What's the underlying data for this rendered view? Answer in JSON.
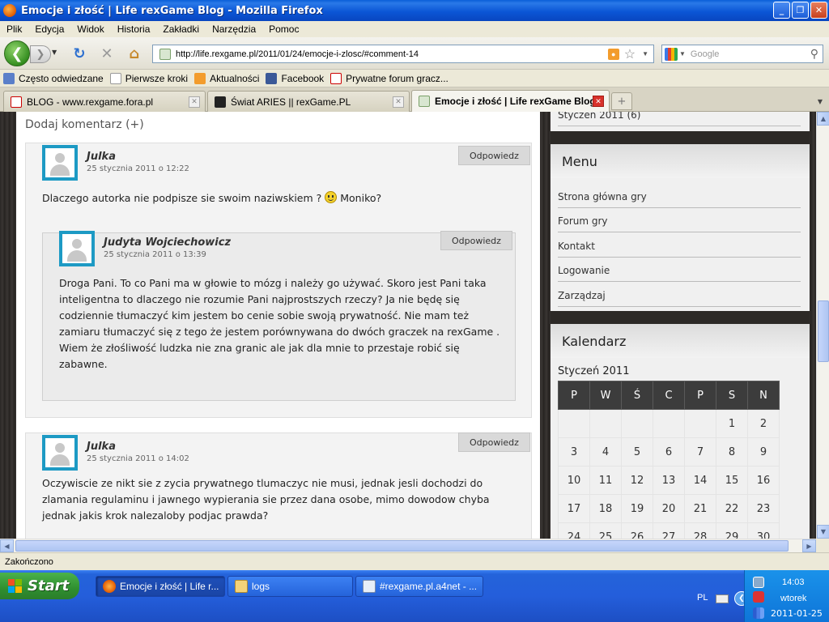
{
  "window": {
    "title": "Emocje i złość | Life rexGame Blog - Mozilla Firefox",
    "buttons": {
      "minimize": "_",
      "maximize": "❐",
      "close": "✕"
    }
  },
  "menu": [
    "Plik",
    "Edycja",
    "Widok",
    "Historia",
    "Zakładki",
    "Narzędzia",
    "Pomoc"
  ],
  "nav": {
    "url": "http://life.rexgame.pl/2011/01/24/emocje-i-zlosc/#comment-14",
    "search_placeholder": "Google"
  },
  "bookmarks": [
    {
      "label": "Często odwiedzane",
      "icon": "most-visited-icon"
    },
    {
      "label": "Pierwsze kroki",
      "icon": "page-icon"
    },
    {
      "label": "Aktualności",
      "icon": "rss-icon"
    },
    {
      "label": "Facebook",
      "icon": "facebook-icon"
    },
    {
      "label": "Prywatne forum gracz...",
      "icon": "rexgame-icon"
    }
  ],
  "tabs": [
    {
      "label": "BLOG - www.rexgame.fora.pl",
      "active": false
    },
    {
      "label": "Świat ARIES || rexGame.PL",
      "active": false
    },
    {
      "label": "Emocje i złość | Life rexGame Blog",
      "active": true
    }
  ],
  "page": {
    "add_comment": "Dodaj komentarz (+)",
    "reply_label": "Odpowiedz",
    "comments": [
      {
        "author": "Julka",
        "date": "25 stycznia 2011 o 12:22",
        "text_before": "Dlaczego autorka nie podpisze sie swoim naziwskiem ?",
        "text_after": "Moniko?",
        "emoticon": "smiley-icon"
      },
      {
        "author": "Judyta Wojciechowicz",
        "date": "25 stycznia 2011 o 13:39",
        "lines": [
          "Droga Pani. To co Pani ma w głowie to mózg i należy go używać. Skoro jest Pani taka",
          "inteligentna to dlaczego nie rozumie Pani najprostszych rzeczy? Ja nie będę się",
          "codziennie tłumaczyć kim jestem bo cenie sobie swoją prywatność. Nie mam też",
          "zamiaru tłumaczyć się z tego że jestem porównywana do dwóch graczek na rexGame .",
          "Wiem że złośliwość ludzka nie zna granic ale jak dla mnie to przestaje robić się",
          "zabawne."
        ]
      },
      {
        "author": "Julka",
        "date": "25 stycznia 2011 o 14:02",
        "lines": [
          "Oczywiscie ze nikt sie z zycia prywatnego tlumaczyc nie musi, jednak jesli dochodzi do",
          "zlamania regulaminu i jawnego wypierania sie przez dana osobe, mimo dowodow chyba",
          "jednak jakis krok nalezaloby podjac prawda?"
        ]
      }
    ]
  },
  "sidebar": {
    "archive_item": "Styczeń 2011 (6)",
    "menu_title": "Menu",
    "menu_links": [
      "Strona główna gry",
      "Forum gry",
      "Kontakt",
      "Logowanie",
      "Zarządzaj"
    ],
    "calendar_title": "Kalendarz",
    "calendar": {
      "caption": "Styczeń 2011",
      "weekdays": [
        "P",
        "W",
        "Ś",
        "C",
        "P",
        "S",
        "N"
      ],
      "weeks": [
        [
          "",
          "",
          "",
          "",
          "",
          "1",
          "2"
        ],
        [
          "3",
          "4",
          "5",
          "6",
          "7",
          "8",
          "9"
        ],
        [
          "10",
          "11",
          "12",
          "13",
          "14",
          "15",
          "16"
        ],
        [
          "17",
          "18",
          "19",
          "20",
          "21",
          "22",
          "23"
        ],
        [
          "24",
          "25",
          "26",
          "27",
          "28",
          "29",
          "30"
        ]
      ]
    }
  },
  "status": "Zakończono",
  "taskbar": {
    "start": "Start",
    "tasks": [
      {
        "label": "Emocje i złość | Life r...",
        "active": true
      },
      {
        "label": "logs",
        "active": false
      },
      {
        "label": "#rexgame.pl.a4net - ...",
        "active": false
      }
    ],
    "lang": "PL",
    "time": "14:03",
    "day": "wtorek",
    "date": "2011-01-25"
  }
}
